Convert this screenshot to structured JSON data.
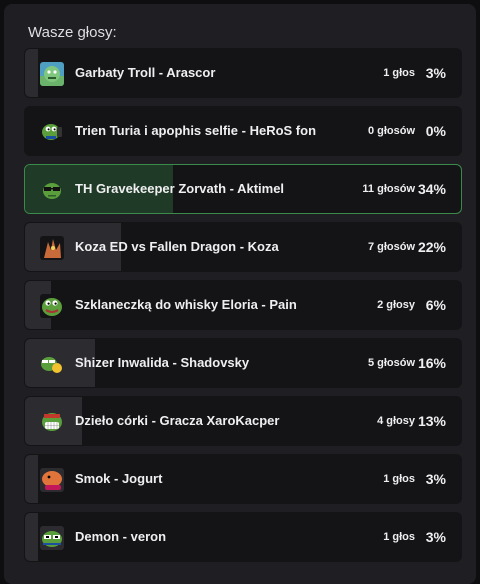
{
  "poll": {
    "title": "Wasze głosy:",
    "options": [
      {
        "label": "Garbaty Troll - Arascor",
        "votes": "1 głos",
        "percent": "3%",
        "share": 3,
        "emote": "troll-emote-icon",
        "selected": false
      },
      {
        "label": "Trien Turia i apophis selfie - HeRoS fon",
        "votes": "0 głosów",
        "percent": "0%",
        "share": 0,
        "emote": "pepe-phone-emote-icon",
        "selected": false
      },
      {
        "label": "TH Gravekeeper Zorvath - Aktimel",
        "votes": "11 głosów",
        "percent": "34%",
        "share": 34,
        "emote": "pepe-glasses-emote-icon",
        "selected": true
      },
      {
        "label": "Koza ED vs Fallen Dragon - Koza",
        "votes": "7 głosów",
        "percent": "22%",
        "share": 22,
        "emote": "dragon-emote-icon",
        "selected": false
      },
      {
        "label": "Szklaneczką do whisky Eloria - Pain",
        "votes": "2 głosy",
        "percent": "6%",
        "share": 6,
        "emote": "pepe-emote-icon",
        "selected": false
      },
      {
        "label": "Shizer Inwalida - Shadovsky",
        "votes": "5 głosów",
        "percent": "16%",
        "share": 16,
        "emote": "pepe-thumbs-emote-icon",
        "selected": false
      },
      {
        "label": "Dzieło córki - Gracza XaroKacper",
        "votes": "4 głosy",
        "percent": "13%",
        "share": 13,
        "emote": "grin-emote-icon",
        "selected": false
      },
      {
        "label": "Smok - Jogurt",
        "votes": "1 głos",
        "percent": "3%",
        "share": 3,
        "emote": "orange-creature-emote-icon",
        "selected": false
      },
      {
        "label": "Demon - veron",
        "votes": "1 głos",
        "percent": "3%",
        "share": 3,
        "emote": "pepe-sunglasses-emote-icon",
        "selected": false
      }
    ]
  }
}
